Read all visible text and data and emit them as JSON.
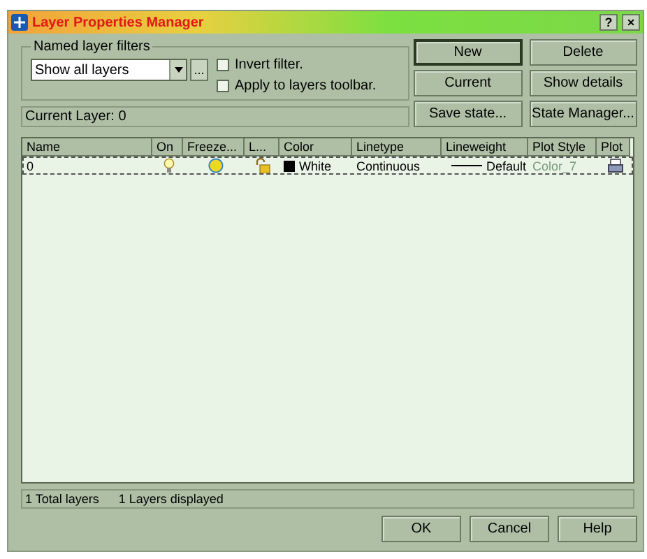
{
  "window": {
    "title": "Layer Properties Manager",
    "help_button": "?",
    "close_button": "×"
  },
  "filters": {
    "legend": "Named layer filters",
    "value": "Show all layers",
    "browse_button": "...",
    "checkboxes": [
      {
        "label": "Invert filter.",
        "checked": false
      },
      {
        "label": "Apply to layers toolbar.",
        "checked": false
      }
    ]
  },
  "buttons": [
    {
      "label": "New",
      "default": true
    },
    {
      "label": "Delete",
      "default": false
    },
    {
      "label": "Current",
      "default": false
    },
    {
      "label": "Show details",
      "default": false
    },
    {
      "label": "Save state...",
      "default": false
    },
    {
      "label": "State Manager...",
      "default": false
    }
  ],
  "current_layer": "Current Layer:  0",
  "table": {
    "columns": [
      "Name",
      "On",
      "Freeze...",
      "L...",
      "Color",
      "Linetype",
      "Lineweight",
      "Plot Style",
      "Plot"
    ],
    "rows": [
      {
        "name": "0",
        "on": true,
        "frozen": false,
        "locked": false,
        "color": "#000000",
        "color_name": "White",
        "linetype": "Continuous",
        "lineweight": "Default",
        "plot_style": "Color_7",
        "plot": true
      }
    ]
  },
  "status_bar": [
    "1 Total layers",
    "1 Layers displayed"
  ],
  "footer_buttons": [
    "OK",
    "Cancel",
    "Help"
  ]
}
